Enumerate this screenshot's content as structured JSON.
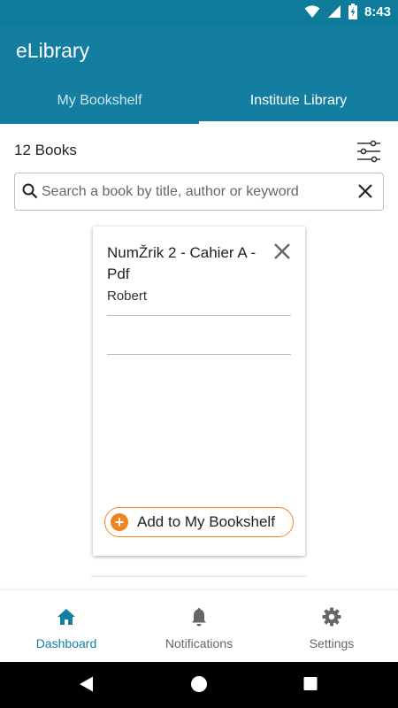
{
  "status_bar": {
    "time": "8:43",
    "icons": [
      "wifi-icon",
      "signal-icon",
      "battery-charging-icon"
    ]
  },
  "app_bar": {
    "title": "eLibrary"
  },
  "tabs": [
    {
      "label": "My Bookshelf",
      "active": false
    },
    {
      "label": "Institute Library",
      "active": true
    }
  ],
  "library": {
    "count_label": "12 Books",
    "search": {
      "placeholder": "Search a book by title, author or keyword",
      "value": ""
    }
  },
  "book_card": {
    "title": "NumŽrik 2 - Cahier A - Pdf",
    "author": "Robert",
    "action_label": "Add to My Bookshelf"
  },
  "bottom_nav": [
    {
      "label": "Dashboard",
      "icon": "home-icon",
      "active": true
    },
    {
      "label": "Notifications",
      "icon": "bell-icon",
      "active": false
    },
    {
      "label": "Settings",
      "icon": "gear-icon",
      "active": false
    }
  ],
  "colors": {
    "primary": "#137ea0",
    "accent": "#f0851f",
    "status_bar": "#0e7b9b"
  }
}
